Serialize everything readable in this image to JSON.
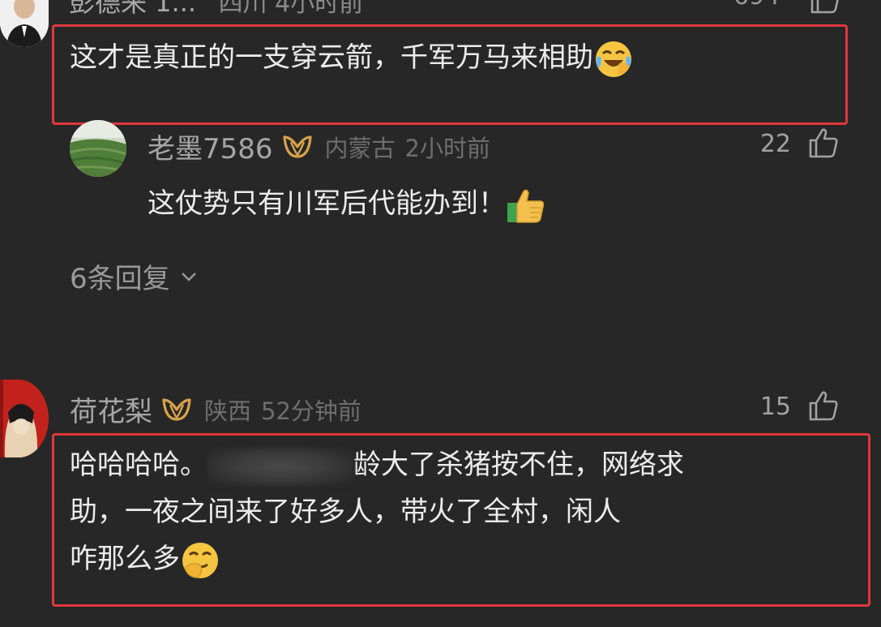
{
  "top_comment": {
    "name_partial": "彭德来 1...",
    "location_partial": "四川 4小时前",
    "like_count_partial": "694",
    "text": "这才是真正的一支穿云箭，千军万马来相助"
  },
  "reply": {
    "name": "老墨7586",
    "location": "内蒙古",
    "time": "2小时前",
    "like_count": "22",
    "text": "这仗势只有川军后代能办到！"
  },
  "replies_link": "6条回复",
  "second_comment": {
    "name": "荷花梨",
    "location": "陕西",
    "time": "52分钟前",
    "like_count": "15",
    "text_line1_start": "哈哈哈哈。",
    "text_line1_end": "龄大了杀猪按不住，网络求",
    "text_line2": "助，一夜之间来了好多人，带火了全村，闲人",
    "text_line3": "咋那么多"
  },
  "colors": {
    "background": "#272727",
    "highlight": "#e0383c",
    "vip_gold": "#d8a24a"
  },
  "icons": [
    "thumbs-up-outline-icon",
    "vip-badge-icon",
    "chevron-down-icon",
    "laughing-crying-emoji",
    "thumbs-up-emoji",
    "giggle-emoji"
  ]
}
